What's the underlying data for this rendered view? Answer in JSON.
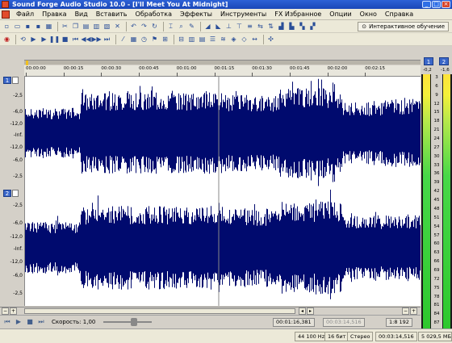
{
  "window": {
    "title": "Sound Forge Audio Studio 10.0 - [I'll Meet You At Midnight]",
    "app_icon_letter": "SF"
  },
  "menu": {
    "items": [
      "Файл",
      "Правка",
      "Вид",
      "Вставить",
      "Обработка",
      "Эффекты",
      "Инструменты",
      "FX Избранное",
      "Опции",
      "Окно",
      "Справка"
    ]
  },
  "toolbar": {
    "learn_button_label": "Интерактивное обучение"
  },
  "ruler": {
    "ticks": [
      "00:00:00",
      "00:00:15",
      "00:00:30",
      "00:00:45",
      "00:01:00",
      "00:01:15",
      "00:01:30",
      "00:01:45",
      "00:02:00",
      "00:02:15"
    ]
  },
  "channels": [
    {
      "number": "1",
      "db_labels": [
        "-2,5",
        "-6,0",
        "-12,0",
        "-Inf.",
        "-12,0",
        "-6,0",
        "-2,5"
      ]
    },
    {
      "number": "2",
      "db_labels": [
        "-2,5",
        "-6,0",
        "-12,0",
        "-Inf.",
        "-12,0",
        "-6,0",
        "-2,5"
      ]
    }
  ],
  "transport": {
    "speed_label": "Скорость: 1,00",
    "cursor_position": "00:01:16,381",
    "selection_end": "00:03:14,516",
    "zoom_ratio": "1:8 192"
  },
  "statusbar": {
    "sample_rate": "44 100 Hz",
    "bit_depth": "16 бит",
    "channels_mode": "Стерео",
    "length": "00:03:14,516",
    "disk_space": "5 029,5 МБ"
  },
  "meters": {
    "channel_labels": [
      "1",
      "2"
    ],
    "peak_left": "-0,2",
    "peak_right": "-1,6",
    "scale": [
      "3",
      "6",
      "9",
      "12",
      "15",
      "18",
      "21",
      "24",
      "27",
      "30",
      "33",
      "36",
      "39",
      "42",
      "45",
      "48",
      "51",
      "54",
      "57",
      "60",
      "63",
      "66",
      "69",
      "72",
      "75",
      "78",
      "81",
      "84",
      "87"
    ]
  },
  "colors": {
    "waveform": "#000a6e",
    "waveform_background": "#ffffff",
    "titlebar": "#2d61d6"
  }
}
